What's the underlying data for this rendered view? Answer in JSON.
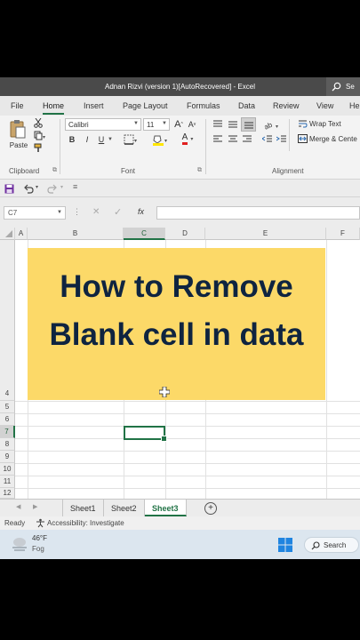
{
  "window": {
    "title": "Adnan Rizvi (version 1)[AutoRecovered]  -  Excel",
    "search_label": "Se"
  },
  "tabs": [
    "File",
    "Home",
    "Insert",
    "Page Layout",
    "Formulas",
    "Data",
    "Review",
    "View",
    "He"
  ],
  "ribbon": {
    "paste_label": "Paste",
    "font_name": "Calibri",
    "font_size": "11",
    "grow_font": "A",
    "shrink_font": "A",
    "bold": "B",
    "italic": "I",
    "underline": "U",
    "font_color_letter": "A",
    "wrap_text": "Wrap Text",
    "merge_center": "Merge & Cente",
    "groups": {
      "clipboard": "Clipboard",
      "font": "Font",
      "alignment": "Alignment"
    }
  },
  "formula_bar": {
    "name_box": "C7",
    "fx": "fx",
    "value": ""
  },
  "columns": [
    "A",
    "B",
    "C",
    "D",
    "E",
    "F"
  ],
  "rows": [
    "4",
    "5",
    "6",
    "7",
    "8",
    "9",
    "10",
    "11",
    "12"
  ],
  "selected": {
    "column": "C",
    "row": "7"
  },
  "banner": {
    "line1": "How to Remove",
    "line2": "Blank cell in data"
  },
  "sheets": [
    "Sheet1",
    "Sheet2",
    "Sheet3"
  ],
  "active_sheet": "Sheet3",
  "status": {
    "ready": "Ready",
    "accessibility": "Accessibility: Investigate"
  },
  "taskbar": {
    "temperature": "46°F",
    "weather": "Fog",
    "search": "Search"
  },
  "colors": {
    "excel_green": "#217346",
    "banner_bg": "#fcd968",
    "banner_text": "#0f2440"
  }
}
